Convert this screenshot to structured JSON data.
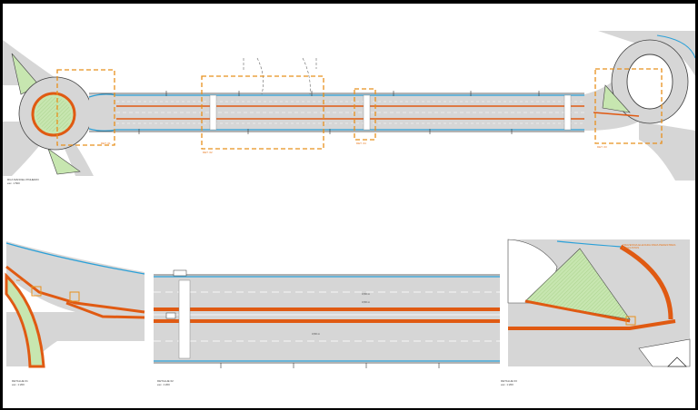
{
  "plan": {
    "title": "RUA MANOEL PINHEIRO",
    "scale": "esc. 1:500",
    "callouts": [
      "DET. 01",
      "DET. 02",
      "DET. 03",
      "DET. 04"
    ]
  },
  "details": [
    {
      "title": "DETALHE 01",
      "scale": "esc. 1:200"
    },
    {
      "title": "DETALHE 02",
      "scale": "esc. 1:200"
    },
    {
      "title": "DETALHE 03",
      "scale": "esc. 1:200"
    }
  ],
  "detail_notes": {
    "d1_tag": "DET. 01",
    "d2_dims": [
      "3,50 m",
      "3,50 m",
      "3,50 m"
    ],
    "d3_note": "TRAVESSIA ELEVADA PARA PEDESTRES E CICLISTAS"
  },
  "colors": {
    "road": "#d6d6d6",
    "cycle_lane": "#e05a12",
    "curb_blue": "#2aa0d8",
    "green_area": "#c7e6b0",
    "callout": "#e8901c"
  }
}
